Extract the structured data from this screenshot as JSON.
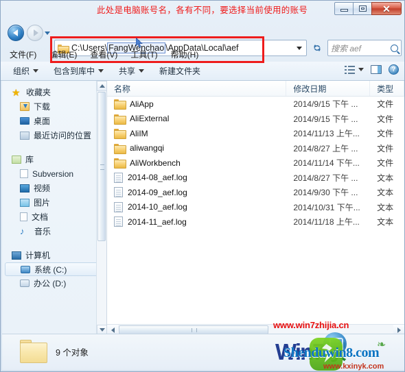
{
  "window": {
    "controls": {
      "minimize": "minimize-button",
      "maximize": "maximize-button",
      "close_glyph": "✕"
    }
  },
  "annotation": {
    "text": "此处是电脑账号名，各有不同，要选择当前使用的账号",
    "color": "#ef1b1b"
  },
  "nav": {
    "back_label": "后退",
    "forward_label": "前进",
    "history_label": "最近浏览的位置"
  },
  "address": {
    "full_path": "C:\\Users\\FangWenchao\\AppData\\Local\\aef",
    "prefix": "C:\\Users\\",
    "selected_segment": "FangWenchao",
    "suffix": "\\AppData\\Local\\aef",
    "highlight_color": "#ee1c1c"
  },
  "refresh": {
    "glyph": "↻"
  },
  "search": {
    "placeholder": "搜索 aef"
  },
  "menubar": {
    "items": [
      {
        "label": "文件(F)"
      },
      {
        "label": "编辑(E)"
      },
      {
        "label": "查看(V)"
      },
      {
        "label": "工具(T)"
      },
      {
        "label": "帮助(H)"
      }
    ]
  },
  "toolbar": {
    "organize": "组织",
    "include_in_library": "包含到库中",
    "share": "共享",
    "new_folder": "新建文件夹",
    "help_glyph": "?"
  },
  "sidebar": {
    "groups": [
      {
        "header": "收藏夹",
        "items": [
          {
            "label": "下载"
          },
          {
            "label": "桌面"
          },
          {
            "label": "最近访问的位置"
          }
        ]
      },
      {
        "header": "库",
        "items": [
          {
            "label": "Subversion"
          },
          {
            "label": "视频"
          },
          {
            "label": "图片"
          },
          {
            "label": "文档"
          },
          {
            "label": "音乐"
          }
        ]
      },
      {
        "header": "计算机",
        "items": [
          {
            "label": "系统 (C:)",
            "selected": true
          },
          {
            "label": "办公 (D:)",
            "selected": false
          }
        ]
      }
    ]
  },
  "filelist": {
    "columns": [
      {
        "label": "名称"
      },
      {
        "label": "修改日期"
      },
      {
        "label": "类型"
      }
    ],
    "rows": [
      {
        "name": "AliApp",
        "date": "2014/9/15 下午 ...",
        "type": "文件",
        "kind": "folder"
      },
      {
        "name": "AliExternal",
        "date": "2014/9/15 下午 ...",
        "type": "文件",
        "kind": "folder"
      },
      {
        "name": "AliIM",
        "date": "2014/11/13 上午...",
        "type": "文件",
        "kind": "folder"
      },
      {
        "name": "aliwangqi",
        "date": "2014/8/27 上午 ...",
        "type": "文件",
        "kind": "folder"
      },
      {
        "name": "AliWorkbench",
        "date": "2014/11/14 下午...",
        "type": "文件",
        "kind": "folder"
      },
      {
        "name": "2014-08_aef.log",
        "date": "2014/8/27 下午 ...",
        "type": "文本",
        "kind": "file"
      },
      {
        "name": "2014-09_aef.log",
        "date": "2014/9/30 下午 ...",
        "type": "文本",
        "kind": "file"
      },
      {
        "name": "2014-10_aef.log",
        "date": "2014/10/31 下午...",
        "type": "文本",
        "kind": "file"
      },
      {
        "name": "2014-11_aef.log",
        "date": "2014/11/18 上午...",
        "type": "文本",
        "kind": "file"
      }
    ]
  },
  "statusbar": {
    "count_text": "9 个对象"
  },
  "watermarks": {
    "red_url": "www.win7zhijia.cn",
    "logo_win": "Win7",
    "logo_jia": "家",
    "shendu": "Shenduwin8.com",
    "kxinyk": "www.kxinyk.com",
    "leaves_glyph": "❧"
  }
}
